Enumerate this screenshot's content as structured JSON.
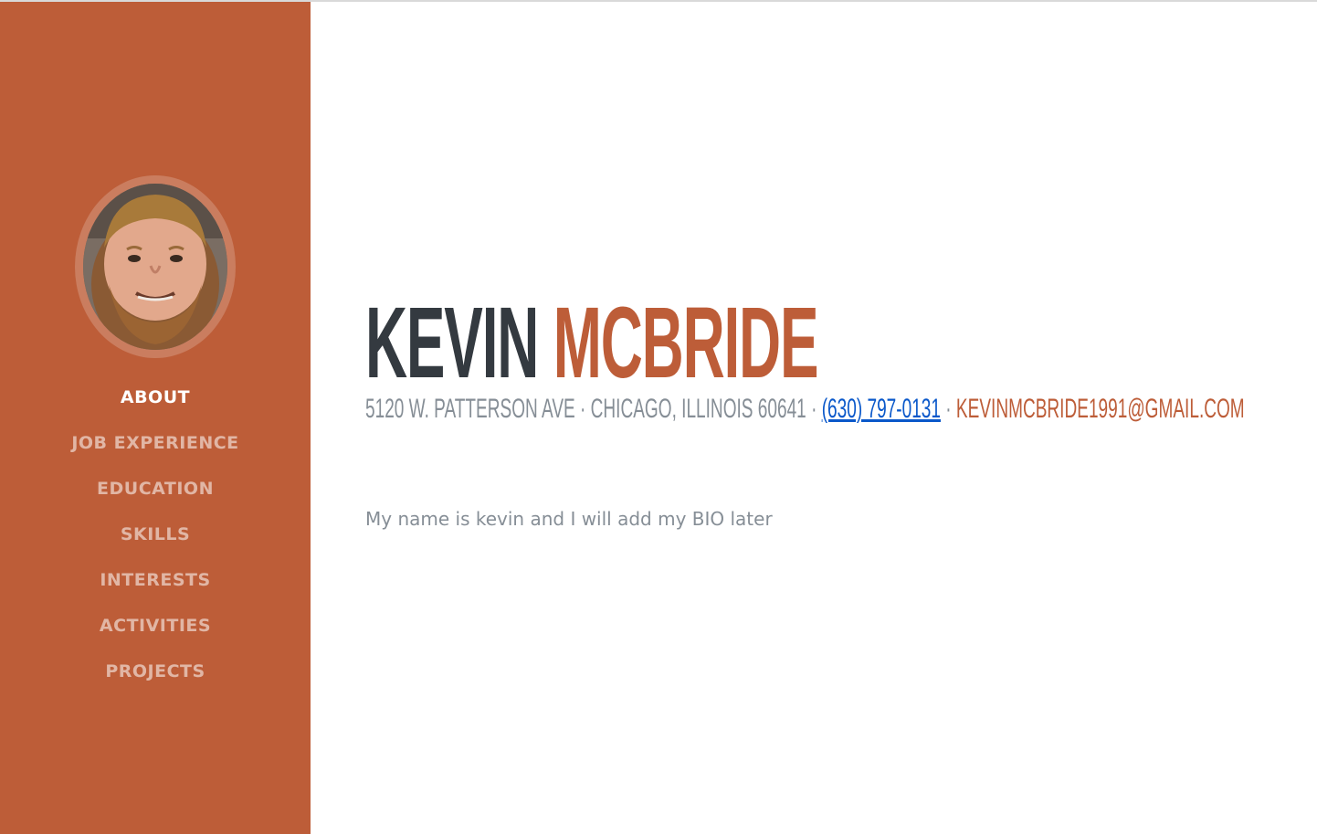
{
  "profile": {
    "first_name": "KEVIN",
    "last_name": "MCBRIDE",
    "address": "5120 W. PATTERSON AVE · CHICAGO, ILLINOIS 60641 ·",
    "separator": "·",
    "phone": "(630) 797-0131",
    "email": "KEVINMCBRIDE1991@GMAIL.COM",
    "bio": "My name is kevin and I will add my BIO later",
    "photo_icon": "profile-photo"
  },
  "nav": {
    "items": [
      {
        "label": "ABOUT",
        "active": true
      },
      {
        "label": "JOB EXPERIENCE",
        "active": false
      },
      {
        "label": "EDUCATION",
        "active": false
      },
      {
        "label": "SKILLS",
        "active": false
      },
      {
        "label": "INTERESTS",
        "active": false
      },
      {
        "label": "ACTIVITIES",
        "active": false
      },
      {
        "label": "PROJECTS",
        "active": false
      }
    ]
  },
  "colors": {
    "primary": "#bd5d38",
    "heading": "#343a40",
    "muted": "#868e96",
    "link": "#0a58ca"
  }
}
